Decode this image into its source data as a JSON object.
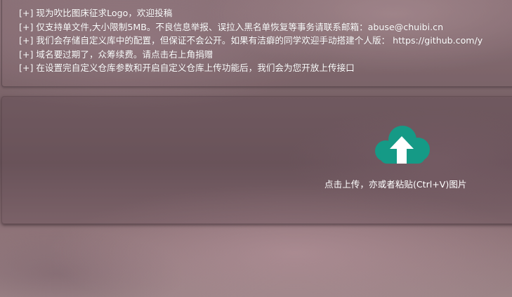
{
  "notices": [
    "[+] 现为吹比图床征求Logo，欢迎投稿",
    "[+] 仅支持单文件,大小限制5MB。不良信息举报、误拉入黑名单恢复等事务请联系邮箱：abuse@chuibi.cn",
    "[+] 我们会存储自定义库中的配置，但保证不会公开。如果有洁癖的同学欢迎手动搭建个人版： https://github.com/y",
    "[+] 域名要过期了，众筹续费。请点击右上角捐赠",
    "[+] 在设置完自定义仓库参数和开启自定义仓库上传功能后，我们会为您开放上传接口"
  ],
  "upload": {
    "prompt": "点击上传，亦或者粘贴(Ctrl+V)图片",
    "icon": "cloud-upload-icon",
    "icon_color": "#159a86"
  }
}
